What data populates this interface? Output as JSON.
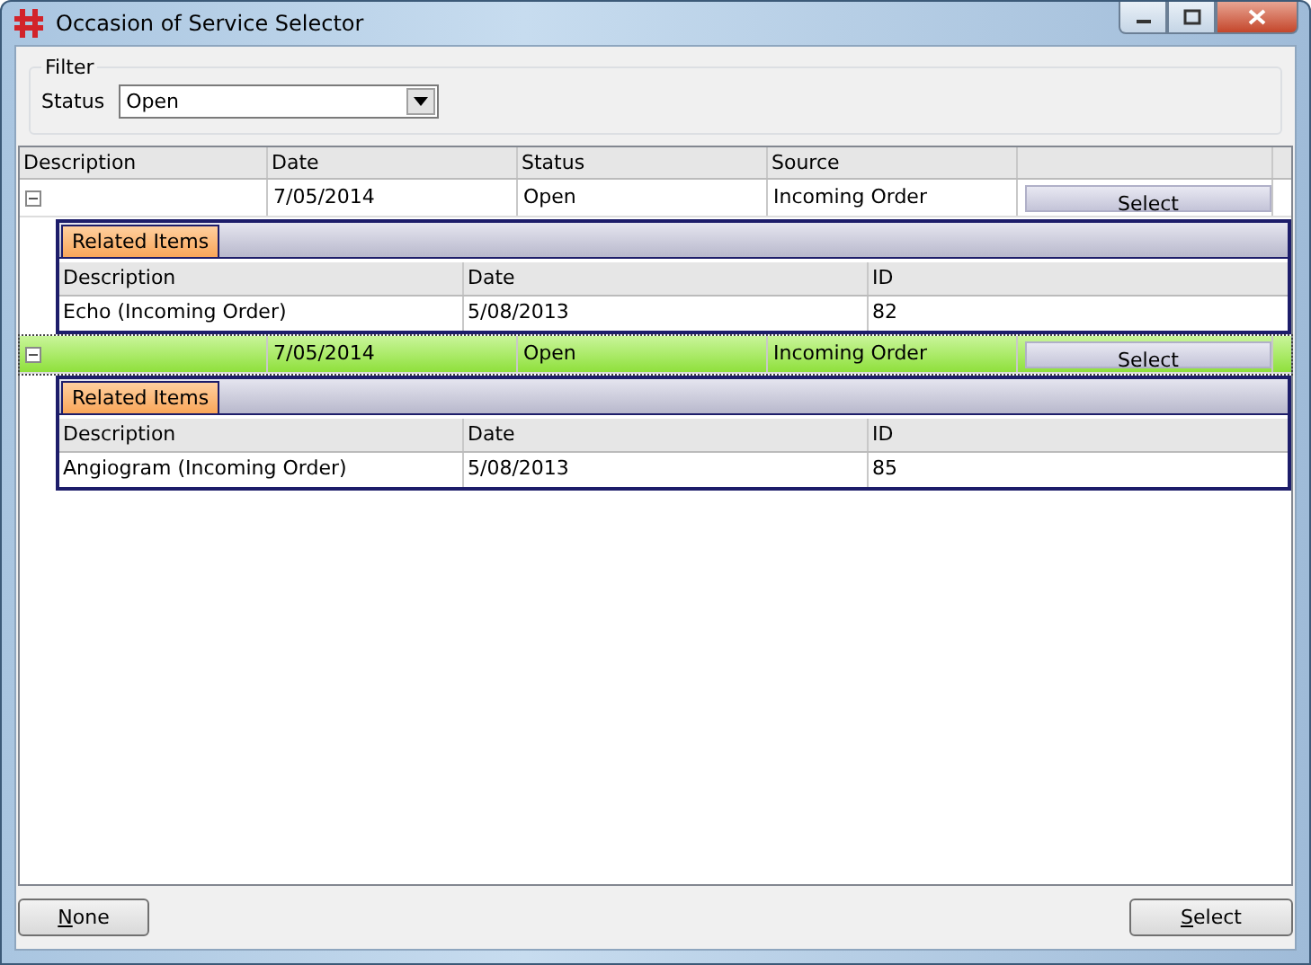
{
  "window": {
    "title": "Occasion of Service Selector"
  },
  "filter": {
    "label": "Filter",
    "status_label": "Status",
    "status_value": "Open"
  },
  "table": {
    "columns": [
      "Description",
      "Date",
      "Status",
      "Source"
    ],
    "rows": [
      {
        "description": "",
        "date": "7/05/2014",
        "status": "Open",
        "source": "Incoming Order",
        "button": "Select",
        "selected": false,
        "expanded": true,
        "related": {
          "tab": "Related Items",
          "columns": [
            "Description",
            "Date",
            "ID"
          ],
          "rows": [
            [
              "Echo (Incoming Order)",
              "5/08/2013",
              "82"
            ]
          ]
        }
      },
      {
        "description": "",
        "date": "7/05/2014",
        "status": "Open",
        "source": "Incoming Order",
        "button": "Select",
        "selected": true,
        "expanded": true,
        "related": {
          "tab": "Related Items",
          "columns": [
            "Description",
            "Date",
            "ID"
          ],
          "rows": [
            [
              "Angiogram (Incoming Order)",
              "5/08/2013",
              "85"
            ]
          ]
        }
      }
    ]
  },
  "buttons": {
    "left": "None",
    "right": "Select"
  }
}
